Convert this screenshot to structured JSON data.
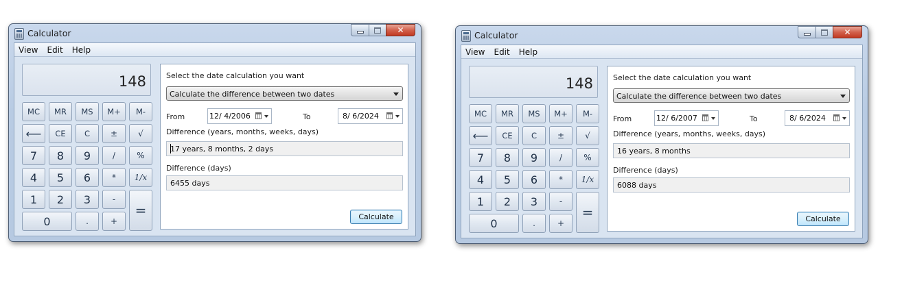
{
  "windows": [
    {
      "title": "Calculator",
      "menu": [
        "View",
        "Edit",
        "Help"
      ],
      "display_value": "148",
      "keys": {
        "row1": [
          "MC",
          "MR",
          "MS",
          "M+",
          "M-"
        ],
        "row2": [
          "⟵",
          "CE",
          "C",
          "±",
          "√"
        ],
        "row3": [
          "7",
          "8",
          "9",
          "/",
          "%"
        ],
        "row4": [
          "4",
          "5",
          "6",
          "*",
          "1/x"
        ],
        "row5": [
          "1",
          "2",
          "3",
          "-",
          "="
        ],
        "row6": [
          "0",
          ".",
          "+"
        ]
      },
      "date_panel": {
        "prompt": "Select the date calculation you want",
        "mode": "Calculate the difference between two dates",
        "from_label": "From",
        "from_date": "12/ 4/2006",
        "to_label": "To",
        "to_date": "8/ 6/2024",
        "diff_label": "Difference (years, months, weeks, days)",
        "diff_value": "17 years, 8 months, 2 days",
        "days_label": "Difference (days)",
        "days_value": "6455 days",
        "calculate_label": "Calculate"
      }
    },
    {
      "title": "Calculator",
      "menu": [
        "View",
        "Edit",
        "Help"
      ],
      "display_value": "148",
      "keys": {
        "row1": [
          "MC",
          "MR",
          "MS",
          "M+",
          "M-"
        ],
        "row2": [
          "⟵",
          "CE",
          "C",
          "±",
          "√"
        ],
        "row3": [
          "7",
          "8",
          "9",
          "/",
          "%"
        ],
        "row4": [
          "4",
          "5",
          "6",
          "*",
          "1/x"
        ],
        "row5": [
          "1",
          "2",
          "3",
          "-",
          "="
        ],
        "row6": [
          "0",
          ".",
          "+"
        ]
      },
      "date_panel": {
        "prompt": "Select the date calculation you want",
        "mode": "Calculate the difference between two dates",
        "from_label": "From",
        "from_date": "12/ 6/2007",
        "to_label": "To",
        "to_date": "8/ 6/2024",
        "diff_label": "Difference (years, months, weeks, days)",
        "diff_value": "16 years, 8 months",
        "days_label": "Difference (days)",
        "days_value": "6088 days",
        "calculate_label": "Calculate"
      }
    }
  ],
  "icons": {
    "app": "calculator-icon",
    "minimize": "minimize-icon",
    "maximize": "maximize-icon",
    "close": "close-icon",
    "dropdown": "chevron-down-icon",
    "calendar": "calendar-icon"
  },
  "colors": {
    "title_gradient": "#c9d8ec",
    "client_bg": "#d9e4f1",
    "close_button": "#c23a22",
    "calculate_button_border": "#3c7fb1"
  }
}
